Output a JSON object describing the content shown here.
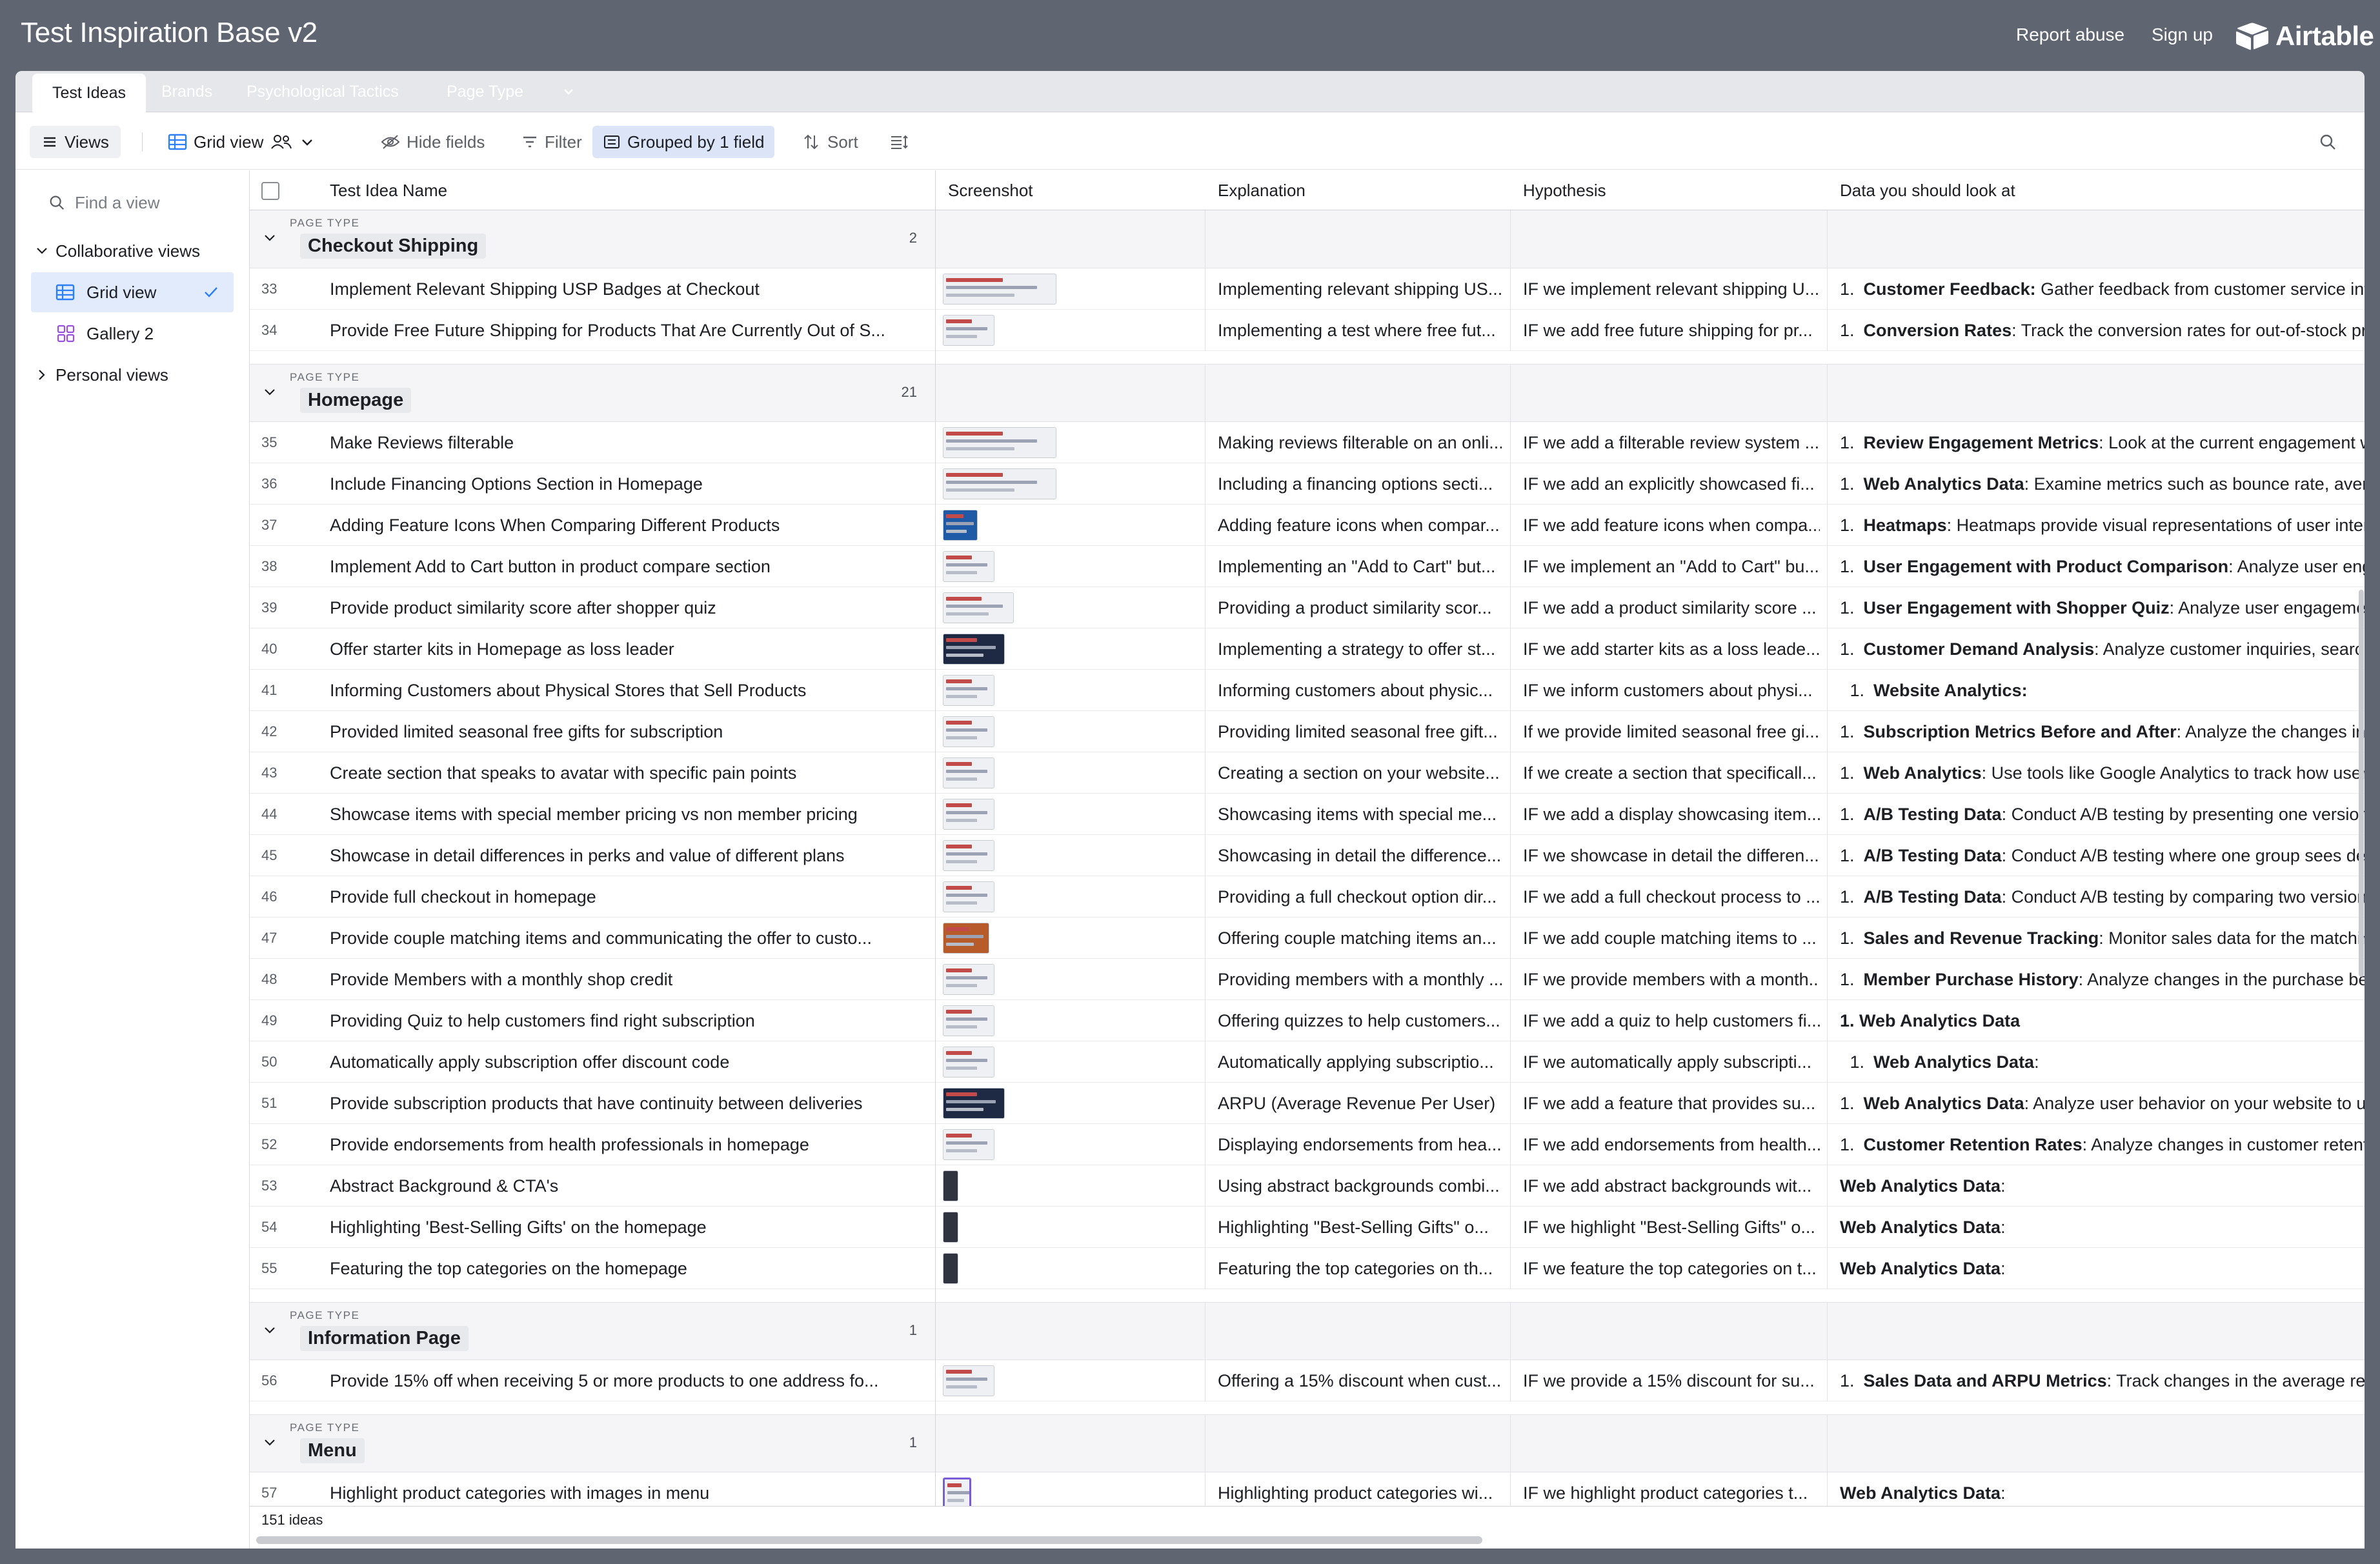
{
  "app": {
    "title": "Test Inspiration Base v2",
    "report_abuse": "Report abuse",
    "sign_up": "Sign up",
    "logo_text": "Airtable"
  },
  "tables": [
    "Test Ideas",
    "Brands",
    "Psychological Tactics",
    "Page Type"
  ],
  "toolbar": {
    "views": "Views",
    "grid_view": "Grid view",
    "hide_fields": "Hide fields",
    "filter": "Filter",
    "grouped": "Grouped by 1 field",
    "sort": "Sort"
  },
  "sidebar": {
    "find_placeholder": "Find a view",
    "collaborative": "Collaborative views",
    "grid_view": "Grid view",
    "gallery": "Gallery 2",
    "personal": "Personal views"
  },
  "columns": [
    "Test Idea Name",
    "Screenshot",
    "Explanation",
    "Hypothesis",
    "Data you should look at"
  ],
  "group_label": "PAGE TYPE",
  "footer": {
    "count": "151 ideas"
  },
  "groups": [
    {
      "name": "Checkout Shipping",
      "count": "2",
      "rows": [
        {
          "n": "33",
          "name": "Implement Relevant Shipping USP Badges at Checkout",
          "exp": "Implementing relevant shipping US...",
          "hyp": "IF we implement relevant shipping U...",
          "data_num": "1.",
          "data_bold": "Customer Feedback:",
          "data_rest": " Gather feedback from customer service interactions",
          "thumb": "wide"
        },
        {
          "n": "34",
          "name": "Provide Free Future Shipping for Products That Are Currently Out of S...",
          "exp": "Implementing a test where free fut...",
          "hyp": "IF we add free future shipping for pr...",
          "data_num": "1.",
          "data_bold": "Conversion Rates",
          "data_rest": ": Track the conversion rates for out-of-stock products",
          "thumb": "small"
        }
      ]
    },
    {
      "name": "Homepage",
      "count": "21",
      "rows": [
        {
          "n": "35",
          "name": "Make Reviews filterable",
          "exp": "Making reviews filterable on an onli...",
          "hyp": "IF we add a filterable review system ...",
          "data_num": "1.",
          "data_bold": "Review Engagement Metrics",
          "data_rest": ": Look at the current engagement with reviews",
          "thumb": "wide"
        },
        {
          "n": "36",
          "name": "Include Financing Options Section in Homepage",
          "exp": "Including a financing options secti...",
          "hyp": "IF we add an explicitly showcased fi...",
          "data_num": "1.",
          "data_bold": "Web Analytics Data",
          "data_rest": ": Examine metrics such as bounce rate, average",
          "thumb": "wide"
        },
        {
          "n": "37",
          "name": "Adding Feature Icons When Comparing Different Products",
          "exp": "Adding feature icons when compar...",
          "hyp": "IF we add feature icons when compa...",
          "data_num": "1.",
          "data_bold": "Heatmaps",
          "data_rest": ": Heatmaps provide visual representations of user interactions",
          "thumb": "blue"
        },
        {
          "n": "38",
          "name": "Implement Add to Cart button in product compare section",
          "exp": "Implementing an \"Add to Cart\" but...",
          "hyp": "IF we implement an \"Add to Cart\" bu...",
          "data_num": "1.",
          "data_bold": "User Engagement with Product Comparison",
          "data_rest": ": Analyze user engagement",
          "thumb": "small"
        },
        {
          "n": "39",
          "name": "Provide product similarity score after shopper quiz",
          "exp": "Providing a product similarity scor...",
          "hyp": "IF we add a product similarity score ...",
          "data_num": "1.",
          "data_bold": "User Engagement with Shopper Quiz",
          "data_rest": ": Analyze user engagement",
          "thumb": "mid"
        },
        {
          "n": "40",
          "name": "Offer starter kits in Homepage as loss leader",
          "exp": "Implementing a strategy to offer st...",
          "hyp": "IF we add starter kits as a loss leade...",
          "data_num": "1.",
          "data_bold": "Customer Demand Analysis",
          "data_rest": ": Analyze customer inquiries, search",
          "thumb": "dark"
        },
        {
          "n": "41",
          "name": "Informing Customers about Physical Stores that Sell Products",
          "exp": "Informing customers about physic...",
          "hyp": "IF we inform customers about physi...",
          "data_num": "1.",
          "data_bold": "Website Analytics:",
          "data_rest": "",
          "thumb": "small"
        },
        {
          "n": "42",
          "name": "Provided limited seasonal free gifts for subscription",
          "exp": "Providing limited seasonal free gift...",
          "hyp": "If we provide limited seasonal free gi...",
          "data_num": "1.",
          "data_bold": "Subscription Metrics Before and After",
          "data_rest": ": Analyze the changes in subscription",
          "thumb": "small"
        },
        {
          "n": "43",
          "name": "Create section that speaks to avatar with specific pain points",
          "exp": "Creating a section on your website...",
          "hyp": "If we create a section that specificall...",
          "data_num": "1.",
          "data_bold": "Web Analytics",
          "data_rest": ": Use tools like Google Analytics to track how users",
          "thumb": "small"
        },
        {
          "n": "44",
          "name": "Showcase items with special member pricing vs non member pricing",
          "exp": "Showcasing items with special me...",
          "hyp": "IF we add a display showcasing item...",
          "data_num": "1.",
          "data_bold": "A/B Testing Data",
          "data_rest": ": Conduct A/B testing by presenting one version",
          "thumb": "small"
        },
        {
          "n": "45",
          "name": "Showcase in detail differences in perks and value of different plans",
          "exp": "Showcasing in detail the difference...",
          "hyp": "IF we showcase in detail the differen...",
          "data_num": "1.",
          "data_bold": "A/B Testing Data",
          "data_rest": ": Conduct A/B testing where one group sees details",
          "thumb": "small"
        },
        {
          "n": "46",
          "name": "Provide full checkout in homepage",
          "exp": "Providing a full checkout option dir...",
          "hyp": "IF we add a full checkout process to ...",
          "data_num": "1.",
          "data_bold": "A/B Testing Data",
          "data_rest": ": Conduct A/B testing by comparing two versions",
          "thumb": "small"
        },
        {
          "n": "47",
          "name": "Provide couple matching items and communicating the offer to custo...",
          "exp": "Offering couple matching items an...",
          "hyp": "IF we add couple matching items to ...",
          "data_num": "1.",
          "data_bold": "Sales and Revenue Tracking",
          "data_rest": ": Monitor sales data for the matching",
          "thumb": "orange"
        },
        {
          "n": "48",
          "name": "Provide Members with a monthly shop credit",
          "exp": "Providing members with a monthly ...",
          "hyp": "IF we provide members with a month...",
          "data_num": "1.",
          "data_bold": "Member Purchase History",
          "data_rest": ": Analyze changes in the purchase behavior",
          "thumb": "small"
        },
        {
          "n": "49",
          "name": "Providing Quiz to help customers find right subscription",
          "exp": "Offering quizzes to help customers...",
          "hyp": "IF we add a quiz to help customers fi...",
          "data_num": "",
          "data_bold": "1. Web Analytics Data",
          "data_rest": "",
          "thumb": "small"
        },
        {
          "n": "50",
          "name": "Automatically apply subscription offer discount code",
          "exp": "Automatically applying subscriptio...",
          "hyp": "IF we automatically apply subscripti...",
          "data_num": "1.",
          "data_bold": "Web Analytics Data",
          "data_rest": ":",
          "thumb": "small"
        },
        {
          "n": "51",
          "name": "Provide subscription products that have continuity between deliveries",
          "exp": "ARPU (Average Revenue Per User) ...",
          "hyp": "IF we add a feature that provides su...",
          "data_num": "1.",
          "data_bold": "Web Analytics Data",
          "data_rest": ": Analyze user behavior on your website to understand",
          "thumb": "dark"
        },
        {
          "n": "52",
          "name": "Provide endorsements from health professionals in homepage",
          "exp": "Displaying endorsements from hea...",
          "hyp": "IF we add endorsements from health...",
          "data_num": "1.",
          "data_bold": "Customer Retention Rates",
          "data_rest": ": Analyze changes in customer retention",
          "thumb": "small"
        },
        {
          "n": "53",
          "name": "Abstract Background & CTA's",
          "exp": "Using abstract backgrounds combi...",
          "hyp": "IF we add abstract backgrounds wit...",
          "data_num": "",
          "data_bold": "Web Analytics Data",
          "data_rest": ":",
          "thumb": "tiny"
        },
        {
          "n": "54",
          "name": "Highlighting 'Best-Selling Gifts' on the homepage",
          "exp": "Highlighting \"Best-Selling Gifts\" o...",
          "hyp": "IF we highlight \"Best-Selling Gifts\" o...",
          "data_num": "",
          "data_bold": "Web Analytics Data",
          "data_rest": ":",
          "thumb": "tiny"
        },
        {
          "n": "55",
          "name": "Featuring the top categories on the homepage",
          "exp": "Featuring the top categories on th...",
          "hyp": "IF we feature the top categories on t...",
          "data_num": "",
          "data_bold": "Web Analytics Data",
          "data_rest": ":",
          "thumb": "tiny"
        }
      ]
    },
    {
      "name": "Information Page",
      "count": "1",
      "rows": [
        {
          "n": "56",
          "name": "Provide 15% off when receiving 5 or more products to one address fo...",
          "exp": "Offering a 15% discount when cust...",
          "hyp": "IF we provide a 15% discount for su...",
          "data_num": "1.",
          "data_bold": "Sales Data and ARPU Metrics",
          "data_rest": ": Track changes in the average revenue",
          "thumb": "small"
        }
      ]
    },
    {
      "name": "Menu",
      "count": "1",
      "rows": [
        {
          "n": "57",
          "name": "Highlight product categories with images in menu",
          "exp": "Highlighting product categories wi...",
          "hyp": "IF we highlight product categories t...",
          "data_num": "",
          "data_bold": "Web Analytics Data",
          "data_rest": ":",
          "thumb": "purple"
        }
      ]
    }
  ],
  "colors": {
    "topbar": "#606572",
    "accent": "#2d7ff9",
    "selected_view": "#e1ebfb",
    "grouped_chip": "#dce5f7",
    "group_band": "#f5f5f7"
  }
}
